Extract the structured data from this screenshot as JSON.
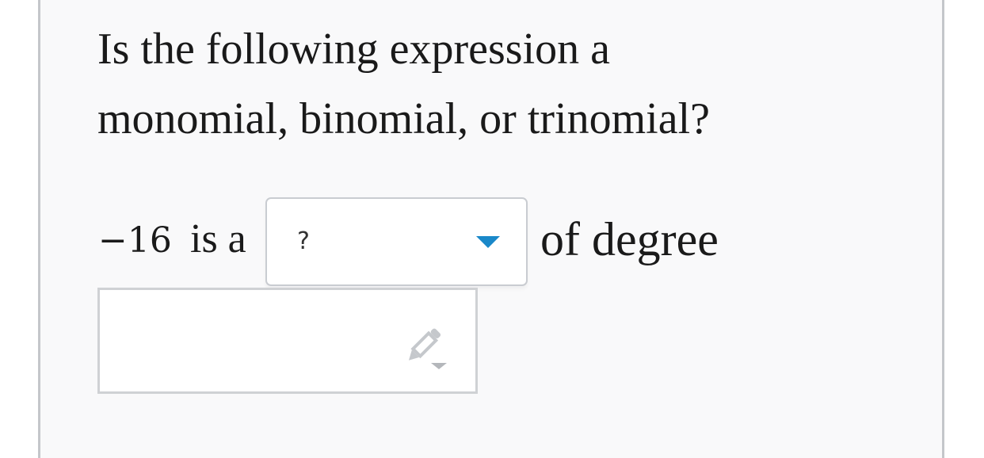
{
  "question": {
    "line1": "Is the following expression a",
    "line2": "monomial, binomial, or trinomial?"
  },
  "expression": {
    "value": "−16",
    "connector": "is a"
  },
  "type_dropdown": {
    "selected": "?",
    "caret_color": "#1a88c9"
  },
  "suffix": "of degree",
  "degree_input": {
    "value": "",
    "icon": "pencil-icon"
  }
}
